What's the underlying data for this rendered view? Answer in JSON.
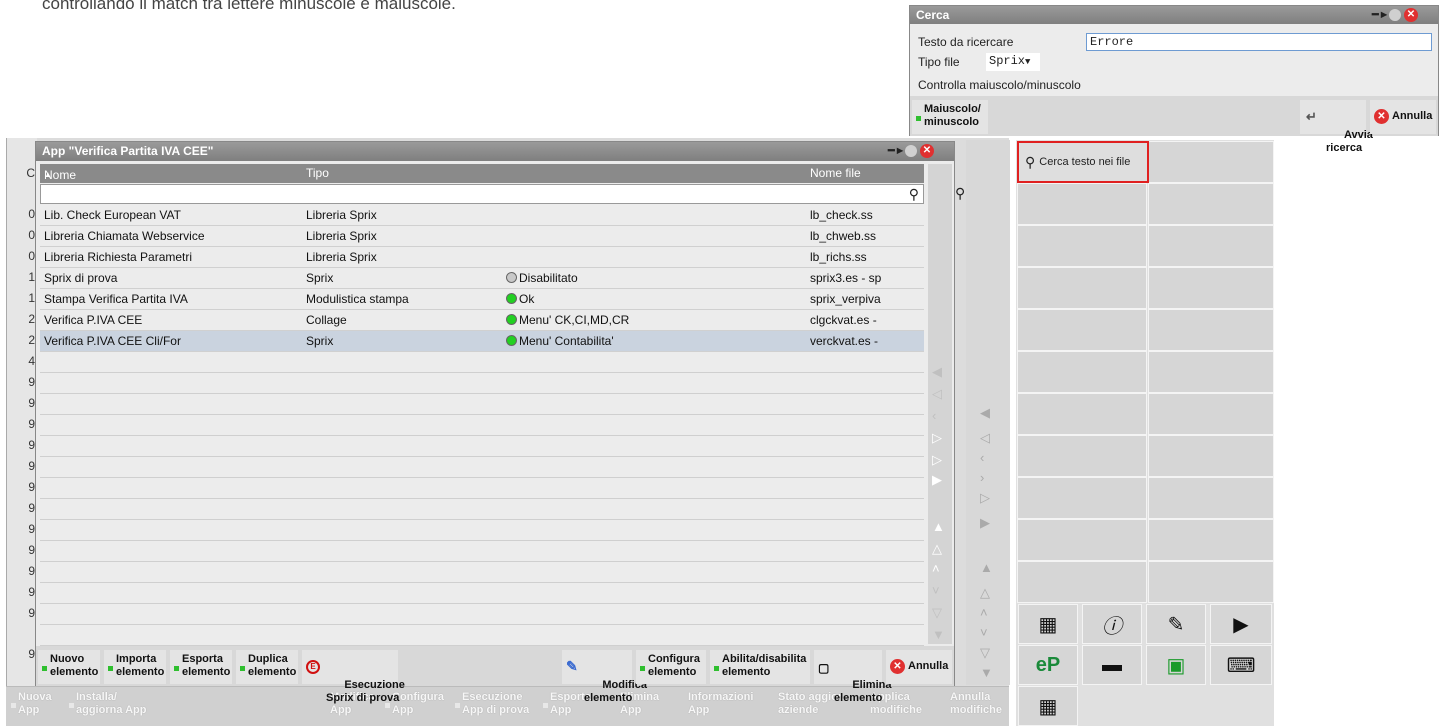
{
  "doc_text": "controllando il match tra lettere minuscole e maiuscole.",
  "bg_row_digits": [
    "0",
    "0",
    "0",
    "1",
    "1",
    "2",
    "2",
    "4",
    "9",
    "9",
    "9",
    "9",
    "9",
    "9",
    "9",
    "9",
    "9",
    "9",
    "9",
    "9",
    "9"
  ],
  "bg_header_letter": "C",
  "bg_buttons": [
    {
      "label": "Nuova\nApp"
    },
    {
      "label": "Installa/\naggiorna App"
    },
    {
      "label": "Modifica\nApp"
    },
    {
      "label": "Configura\nApp"
    },
    {
      "label": "Esecuzione\nApp di prova"
    },
    {
      "label": "Esporta\nApp"
    },
    {
      "label": "Elimina\nApp"
    },
    {
      "label": "Informazioni\nApp"
    },
    {
      "label": "Stato aggior.\naziende"
    },
    {
      "label": "Applica\nmodifiche"
    },
    {
      "label": "Annulla\nmodifiche"
    }
  ],
  "right_panel": {
    "search_files_label": "Cerca testo nei file",
    "icons": [
      "factory-transfer-icon",
      "info-icon",
      "signature-icon",
      "video-player-icon",
      "ep-lock-icon",
      "card-icon",
      "basket-icon",
      "keyboard-icon",
      "numpad-icon"
    ]
  },
  "dialog": {
    "title": "App \"Verifica Partita IVA CEE\"",
    "columns": {
      "name": "Nome",
      "type": "Tipo",
      "file": "Nome file"
    },
    "rows": [
      {
        "name": "Lib. Check European VAT",
        "type": "Libreria Sprix",
        "status": "",
        "status_color": "",
        "file": "lb_check.ss"
      },
      {
        "name": "Libreria Chiamata Webservice",
        "type": "Libreria Sprix",
        "status": "",
        "status_color": "",
        "file": "lb_chweb.ss"
      },
      {
        "name": "Libreria Richiesta Parametri",
        "type": "Libreria Sprix",
        "status": "",
        "status_color": "",
        "file": "lb_richs.ss"
      },
      {
        "name": "Sprix di prova",
        "type": "Sprix",
        "status": "Disabilitato",
        "status_color": "#c8c8c8",
        "file": "sprix3.es - sp"
      },
      {
        "name": "Stampa Verifica Partita IVA",
        "type": "Modulistica stampa",
        "status": "Ok",
        "status_color": "#22d022",
        "file": "sprix_verpiva"
      },
      {
        "name": "Verifica P.IVA CEE",
        "type": "Collage",
        "status": "Menu' CK,CI,MD,CR",
        "status_color": "#22d022",
        "file": "clgckvat.es -"
      },
      {
        "name": "Verifica P.IVA CEE Cli/For",
        "type": "Sprix",
        "status": "Menu' Contabilita'",
        "status_color": "#22d022",
        "file": "verckvat.es -"
      }
    ],
    "buttons": [
      {
        "label": "Nuovo\nelemento"
      },
      {
        "label": "Importa\nelemento"
      },
      {
        "label": "Esporta\nelemento"
      },
      {
        "label": "Duplica\nelemento"
      },
      {
        "label": "Esecuzione\nSprix di prova"
      },
      {
        "label": "Modifica\nelemento"
      },
      {
        "label": "Configura\nelemento"
      },
      {
        "label": "Abilita/disabilita\nelemento"
      },
      {
        "label": "Elimina\nelemento"
      },
      {
        "label": "Annulla"
      }
    ]
  },
  "search_dialog": {
    "title": "Cerca",
    "search_label": "Testo da ricercare",
    "search_value": "Errore",
    "filetype_label": "Tipo file",
    "filetype_value": "Sprix",
    "case_label": "Controlla maiuscolo/minuscolo",
    "buttons": [
      {
        "label": "Maiuscolo/\nminuscolo"
      },
      {
        "label": "Avvia\nricerca"
      },
      {
        "label": "Annulla"
      }
    ]
  },
  "colors": {
    "accent_red": "#e02020",
    "status_green": "#22d022",
    "selection": "#cad3df"
  }
}
